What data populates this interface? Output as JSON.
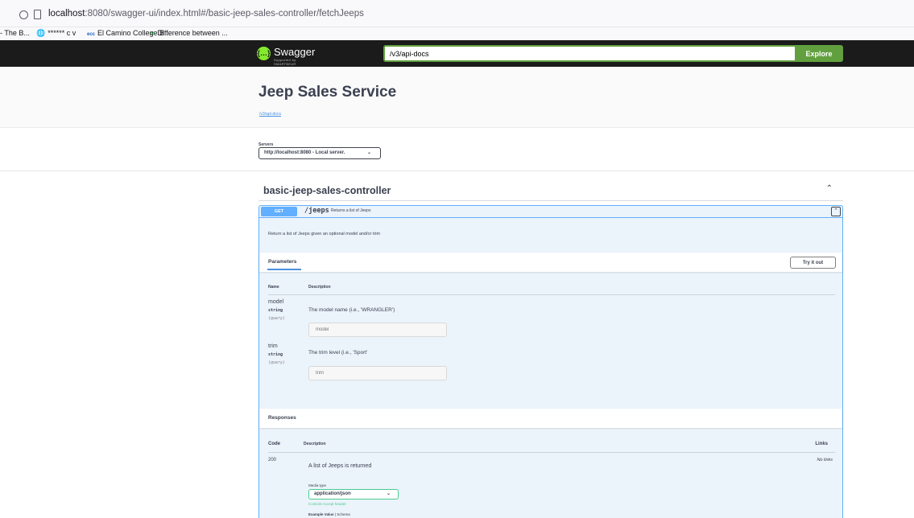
{
  "browser": {
    "url_host": "localhost",
    "url_rest": ":8080/swagger-ui/index.html#/basic-jeep-sales-controller/fetchJeeps",
    "bookmarks": [
      {
        "icon": "",
        "label": "- The B..."
      },
      {
        "icon": "globe-icon",
        "label": "****** c v"
      },
      {
        "icon": "ecc-icon",
        "label": "El Camino College B..."
      },
      {
        "icon": "ge-icon",
        "label": "Difference between ..."
      }
    ]
  },
  "topbar": {
    "logo_text": "Swagger",
    "logo_sub": "Supported by SMARTBEAR",
    "spec_url": "/v3/api-docs",
    "explore_label": "Explore",
    "accent": "#62a03f"
  },
  "info": {
    "title": "Jeep Sales Service",
    "link": "/v3/api-docs"
  },
  "servers": {
    "label": "Servers",
    "selected": "http://localhost:8080 - Local server."
  },
  "tag": {
    "name": "basic-jeep-sales-controller",
    "caret": "^"
  },
  "operation": {
    "method": "GET",
    "path": "/jeeps",
    "summary": "Returns a list of Jeeps",
    "description": "Return a list of Jeeps given an optional model and/or trim",
    "method_color": "#61affe",
    "parameters": {
      "title": "Parameters",
      "try_label": "Try it out",
      "col_name": "Name",
      "col_desc": "Description",
      "items": [
        {
          "name": "model",
          "type": "string",
          "in": "(query)",
          "description": "The model name (i.e., 'WRANGLER')",
          "placeholder": "model"
        },
        {
          "name": "trim",
          "type": "string",
          "in": "(query)",
          "description": "The trim level (i.e., 'Sport'",
          "placeholder": "trim"
        }
      ]
    },
    "responses": {
      "title": "Responses",
      "col_code": "Code",
      "col_desc": "Description",
      "col_links": "Links",
      "items": [
        {
          "code": "200",
          "description": "A list of Jeeps is returned",
          "links": "No links",
          "media_label": "Media type",
          "media_type": "application/json",
          "accept_note": "Controls Accept header.",
          "example_value": "Example Value",
          "schema": "Schema"
        }
      ]
    }
  }
}
